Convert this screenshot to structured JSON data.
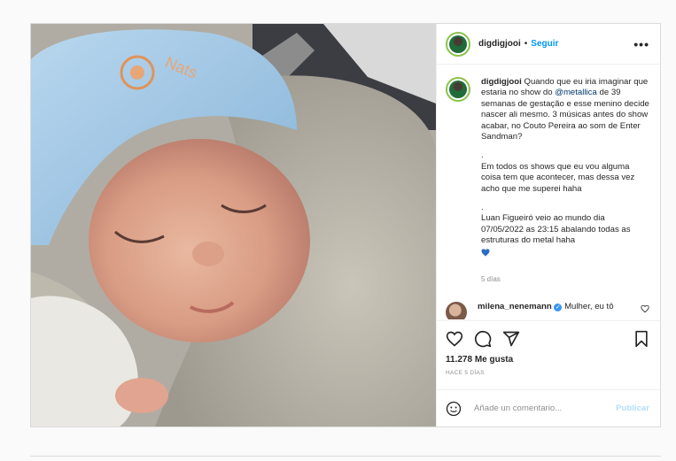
{
  "post": {
    "username": "digdigjooi",
    "follow_label": "Seguir",
    "more_label": "•••",
    "caption": {
      "line1_prefix": "Quando que eu iria imaginar que estaria no show do ",
      "mention": "@metallica",
      "line1_suffix": " de 39 semanas de gestação e esse menino decide nascer ali mesmo. 3 músicas antes do show acabar, no Couto Pereira ao som de Enter Sandman?",
      "sep1": ".",
      "p2": "Em todos os shows que eu vou alguma coisa tem que acontecer, mas dessa vez acho que me superei haha",
      "sep2": ".",
      "p3": "Luan Figueiró veio ao mundo dia 07/05/2022 as 23:15 abalando todas as estruturas do metal haha"
    },
    "caption_time": "5 días",
    "comment": {
      "username": "milena_nenemann",
      "text": "Mulher, eu tô"
    },
    "likes": "11.278 Me gusta",
    "ago": "HACE 5 DÍAS",
    "comment_placeholder": "Añade un comentario...",
    "publish_label": "Publicar",
    "colors": {
      "accent": "#0095f6",
      "verified": "#3897f0",
      "emoji_heart": "#2b6cc4"
    },
    "icons": [
      "heart-icon",
      "comment-icon",
      "share-icon",
      "bookmark-icon",
      "emoji-icon",
      "verified-icon"
    ]
  }
}
